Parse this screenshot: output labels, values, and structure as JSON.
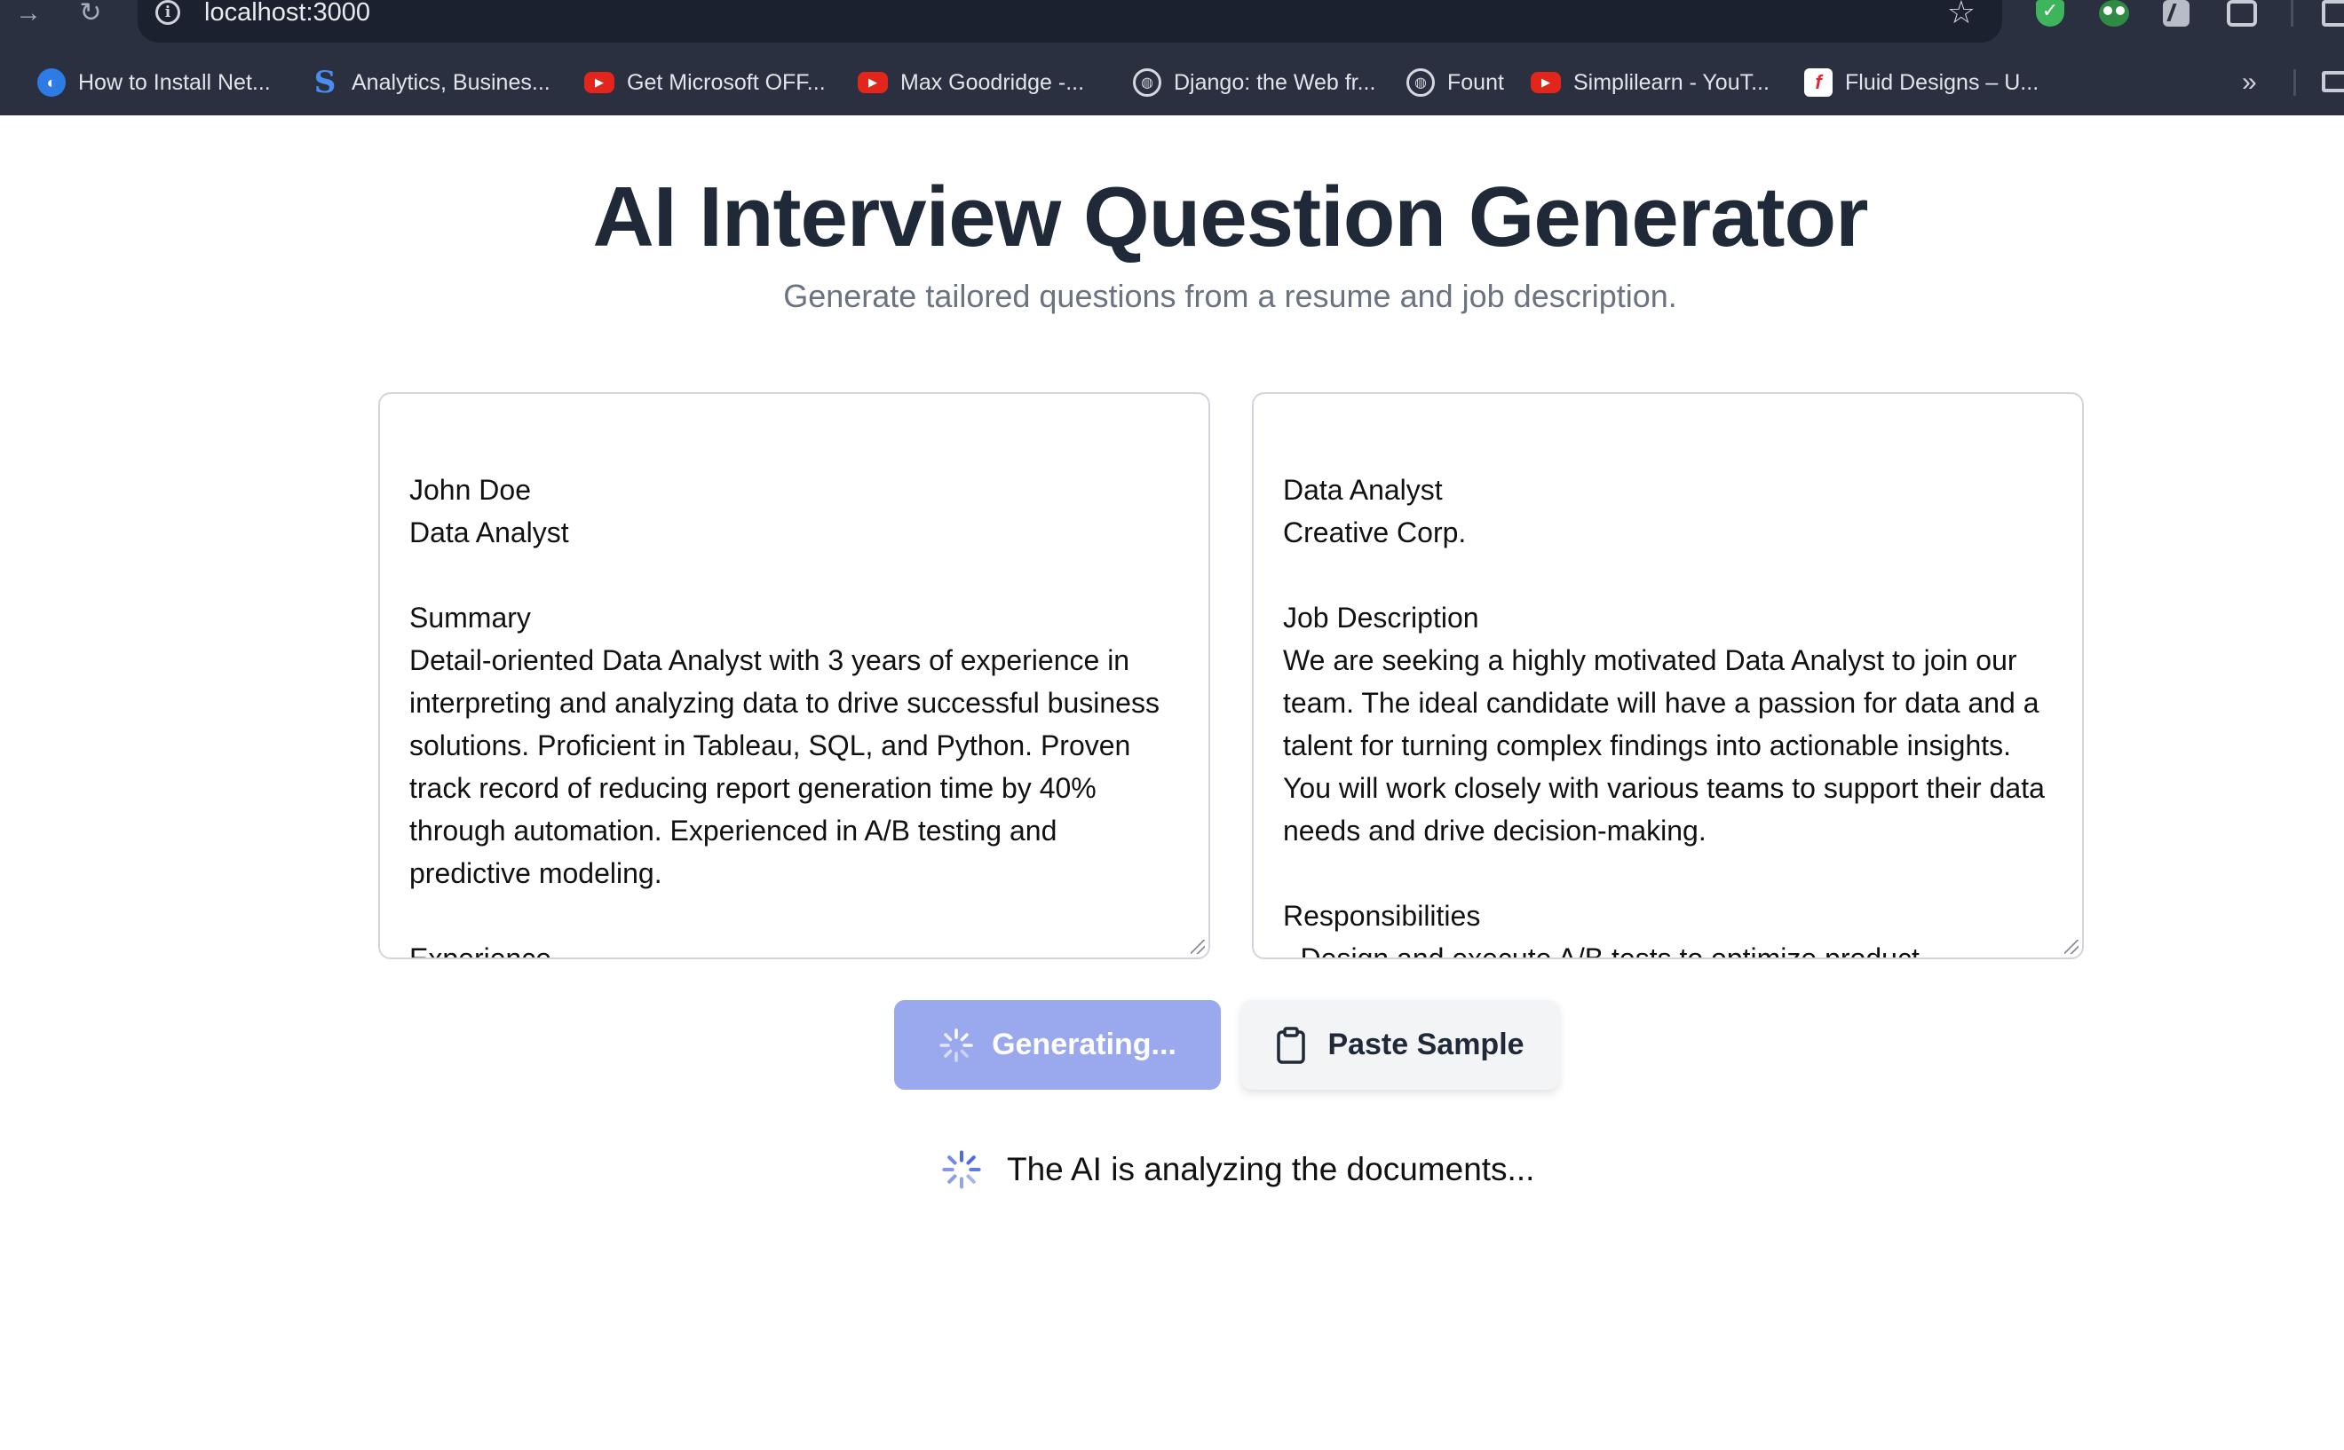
{
  "browser": {
    "url": "localhost:3000",
    "bookmarks": [
      {
        "label": "How to Install Net...",
        "icon": "blue-globe-icon"
      },
      {
        "label": "Analytics, Busines...",
        "icon": "s-logo-icon"
      },
      {
        "label": "Get Microsoft OFF...",
        "icon": "youtube-icon"
      },
      {
        "label": "Max Goodridge -...",
        "icon": "youtube-icon"
      },
      {
        "label": "Django: the Web fr...",
        "icon": "globe-icon"
      },
      {
        "label": "Fount",
        "icon": "globe-icon"
      },
      {
        "label": "Simplilearn - YouT...",
        "icon": "youtube-icon"
      },
      {
        "label": "Fluid Designs – U...",
        "icon": "fluid-icon"
      }
    ],
    "more_label": "»"
  },
  "header": {
    "title": "AI Interview Question Generator",
    "subtitle": "Generate tailored questions from a resume and job description."
  },
  "resume": {
    "text": "John Doe\nData Analyst\n\nSummary\nDetail-oriented Data Analyst with 3 years of experience in interpreting and analyzing data to drive successful business solutions. Proficient in Tableau, SQL, and Python. Proven track record of reducing report generation time by 40% through automation. Experienced in A/B testing and predictive modeling.\n\nExperience"
  },
  "job": {
    "text": "Data Analyst\nCreative Corp.\n\nJob Description\nWe are seeking a highly motivated Data Analyst to join our team. The ideal candidate will have a passion for data and a talent for turning complex findings into actionable insights. You will work closely with various teams to support their data needs and drive decision-making.\n\nResponsibilities\n- Design and execute A/B tests to optimize product"
  },
  "actions": {
    "generate_label": "Generating...",
    "paste_label": "Paste Sample"
  },
  "status": {
    "text": "The AI is analyzing the documents..."
  },
  "colors": {
    "title": "#1f2937",
    "generate_button": "#9aa8ee",
    "spinner_accent": "#4f6be0"
  }
}
